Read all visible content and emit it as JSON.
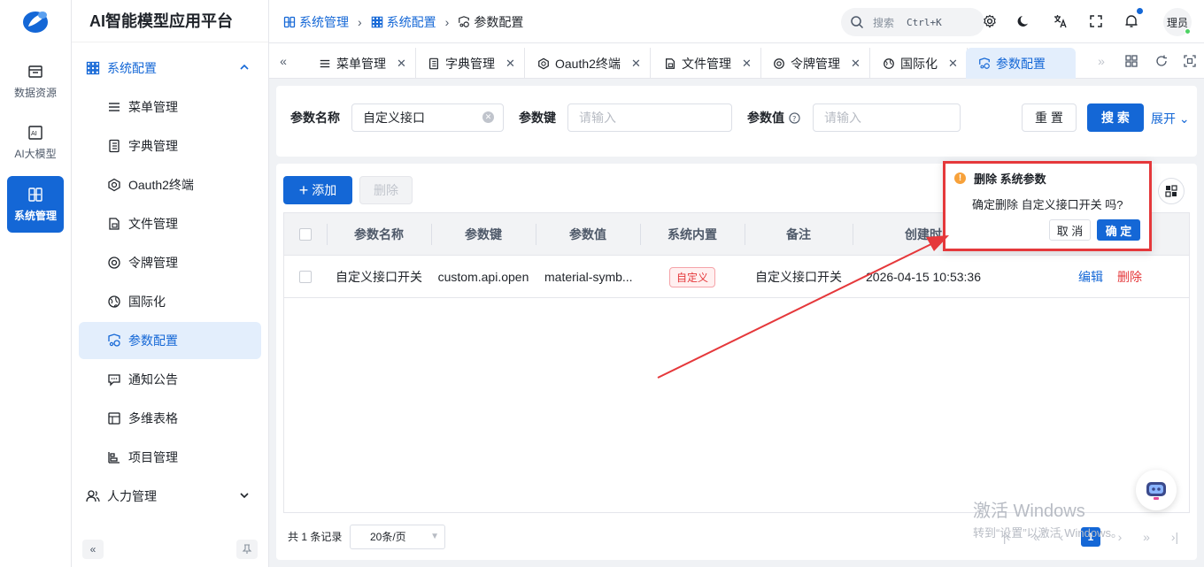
{
  "app_title": "AI智能模型应用平台",
  "rail": [
    {
      "label": "数据资源",
      "icon": "database-icon",
      "active": false
    },
    {
      "label": "AI大模型",
      "icon": "ai-model-icon",
      "active": false
    },
    {
      "label": "系统管理",
      "icon": "system-icon",
      "active": true
    }
  ],
  "menu": {
    "group_system": "系统配置",
    "items": [
      {
        "label": "菜单管理",
        "icon": "menu-icon"
      },
      {
        "label": "字典管理",
        "icon": "dictionary-icon"
      },
      {
        "label": "Oauth2终端",
        "icon": "oauth-icon"
      },
      {
        "label": "文件管理",
        "icon": "file-icon"
      },
      {
        "label": "令牌管理",
        "icon": "token-icon"
      },
      {
        "label": "国际化",
        "icon": "globe-icon"
      },
      {
        "label": "参数配置",
        "icon": "settings-param-icon",
        "active": true
      },
      {
        "label": "通知公告",
        "icon": "notice-icon"
      },
      {
        "label": "多维表格",
        "icon": "table-icon"
      },
      {
        "label": "项目管理",
        "icon": "project-icon"
      }
    ],
    "group_hr": "人力管理"
  },
  "breadcrumb": [
    "系统管理",
    "系统配置",
    "参数配置"
  ],
  "header": {
    "search_placeholder": "搜索",
    "search_shortcut": "Ctrl+K",
    "avatar_text": "理员"
  },
  "tabs": [
    {
      "label": "菜单管理",
      "active": false
    },
    {
      "label": "字典管理",
      "active": false
    },
    {
      "label": "Oauth2终端",
      "active": false
    },
    {
      "label": "文件管理",
      "active": false
    },
    {
      "label": "令牌管理",
      "active": false
    },
    {
      "label": "国际化",
      "active": false
    },
    {
      "label": "参数配置",
      "active": true
    }
  ],
  "filter": {
    "name_label": "参数名称",
    "name_value": "自定义接口",
    "key_label": "参数键",
    "key_placeholder": "请输入",
    "value_label": "参数值",
    "value_placeholder": "请输入",
    "reset_label": "重 置",
    "search_label": "搜 索",
    "expand_label": "展开"
  },
  "toolbar": {
    "add_label": "添加",
    "delete_label": "删除"
  },
  "table": {
    "columns": [
      "参数名称",
      "参数键",
      "参数值",
      "系统内置",
      "备注",
      "创建时"
    ],
    "rows": [
      {
        "name": "自定义接口开关",
        "key": "custom.api.open",
        "value": "material-symb...",
        "builtin": "自定义",
        "remark": "自定义接口开关",
        "created": "2026-04-15 10:53:36",
        "edit": "编辑",
        "delete": "删除"
      }
    ]
  },
  "pager": {
    "total": "共 1 条记录",
    "page_size": "20条/页",
    "current": "1"
  },
  "popconfirm": {
    "title": "删除 系统参数",
    "message": "确定删除 自定义接口开关 吗?",
    "cancel": "取 消",
    "ok": "确 定"
  },
  "watermark": {
    "line1": "激活 Windows",
    "line2": "转到“设置”以激活 Windows。"
  },
  "colors": {
    "primary": "#1467d6",
    "danger": "#e5383b",
    "highlight_box": "#e5383b"
  }
}
